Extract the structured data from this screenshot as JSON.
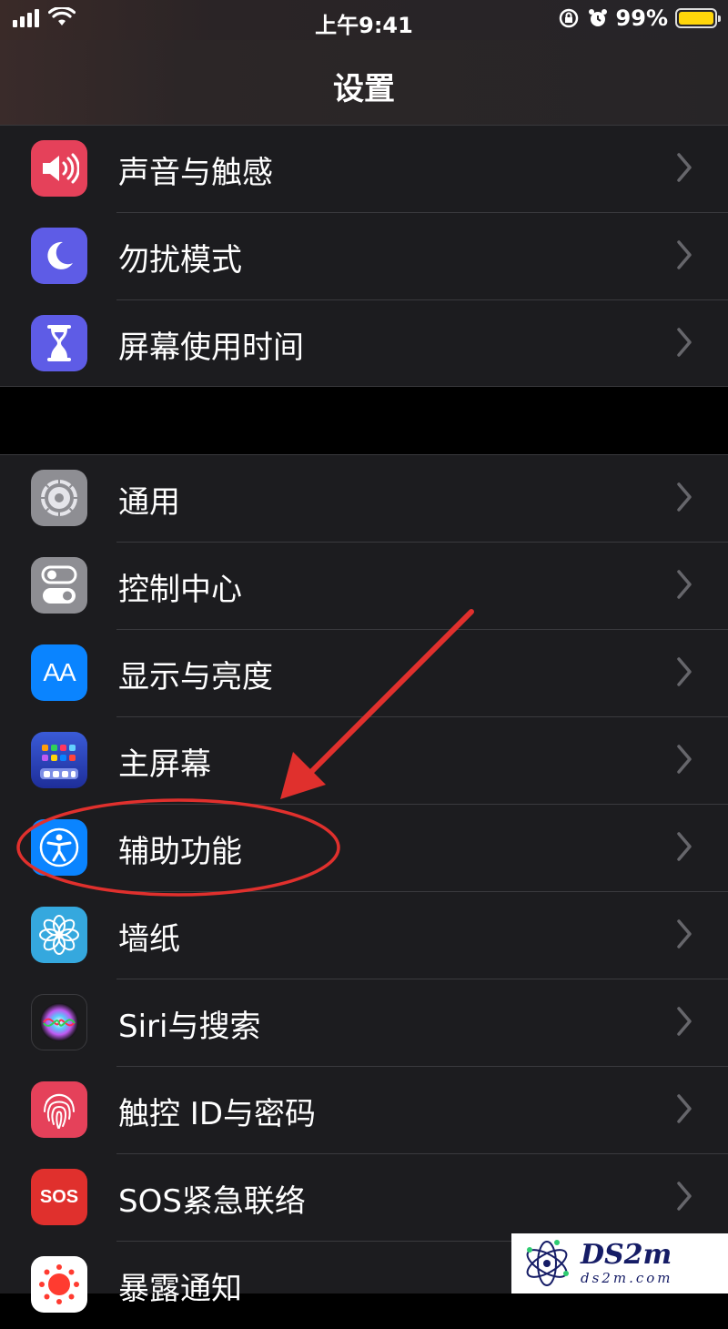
{
  "status_bar": {
    "time": "上午9:41",
    "battery": "99%",
    "battery_level": 0.99
  },
  "nav": {
    "title": "设置"
  },
  "group1": [
    {
      "label": "声音与触感",
      "icon": "speaker-icon",
      "color": "#e5415a"
    },
    {
      "label": "勿扰模式",
      "icon": "moon-icon",
      "color": "#5e5ce6"
    },
    {
      "label": "屏幕使用时间",
      "icon": "hourglass-icon",
      "color": "#5e5ce6"
    }
  ],
  "group2": [
    {
      "label": "通用",
      "icon": "gear-icon",
      "color": "#8e8e93"
    },
    {
      "label": "控制中心",
      "icon": "toggle-icon",
      "color": "#8e8e93"
    },
    {
      "label": "显示与亮度",
      "icon": "aa-icon",
      "color": "#0a84ff",
      "icon_text": "AA"
    },
    {
      "label": "主屏幕",
      "icon": "grid-icon",
      "color": "#2f47c9"
    },
    {
      "label": "辅助功能",
      "icon": "accessibility-icon",
      "color": "#0a84ff"
    },
    {
      "label": "墙纸",
      "icon": "flower-icon",
      "color": "#35a8de"
    },
    {
      "label": "Siri与搜索",
      "icon": "siri-icon",
      "color": "#1c1c1e"
    },
    {
      "label": "触控 ID与密码",
      "icon": "fingerprint-icon",
      "color": "#e5415a"
    },
    {
      "label": "SOS紧急联络",
      "icon": "sos-icon",
      "color": "#e0302d",
      "icon_text": "SOS"
    },
    {
      "label": "暴露通知",
      "icon": "exposure-icon",
      "color": "#ffffff"
    }
  ],
  "watermark": {
    "main": "DS2m",
    "sub": "ds2m.com"
  },
  "annotation_color": "#e0302d"
}
